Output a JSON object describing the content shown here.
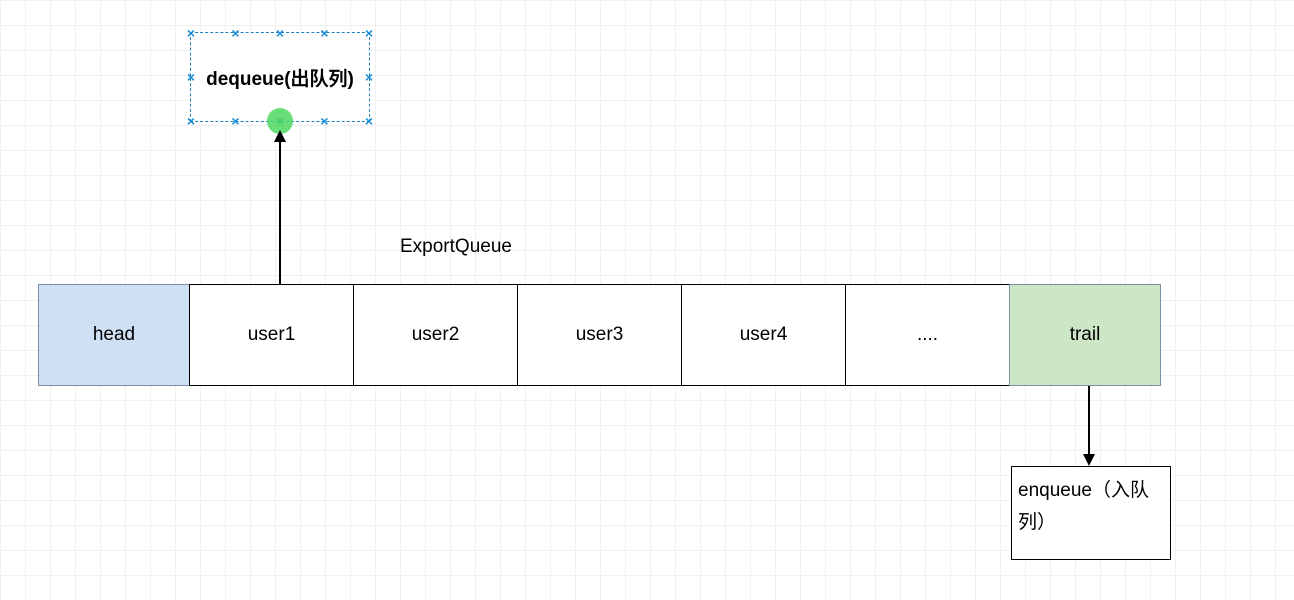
{
  "dequeue": {
    "label": "dequeue(出队列)"
  },
  "queue": {
    "title": "ExportQueue",
    "head": "head",
    "cells": [
      "user1",
      "user2",
      "user3",
      "user4",
      "...."
    ],
    "trail": "trail"
  },
  "enqueue": {
    "label": "enqueue（入队列）"
  }
}
